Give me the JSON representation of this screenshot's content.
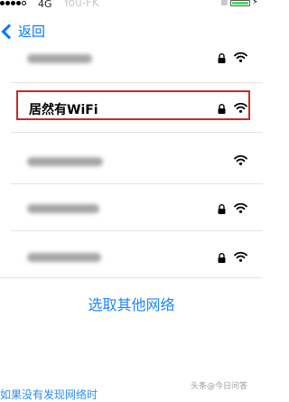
{
  "status_bar": {
    "carrier": "4G",
    "watermark": "You-FK",
    "battery_color": "#4cd964"
  },
  "nav": {
    "back_label": "返回",
    "back_icon": "chevron-left-icon",
    "accent": "#007aff"
  },
  "networks": [
    {
      "name": "",
      "blurred": true,
      "locked": true
    },
    {
      "name": "居然有WiFi",
      "blurred": false,
      "locked": true,
      "highlighted": true
    },
    {
      "name": "",
      "blurred": true,
      "locked": false
    },
    {
      "name": "",
      "blurred": true,
      "locked": true
    },
    {
      "name": "",
      "blurred": true,
      "locked": true
    }
  ],
  "other_network_label": "选取其他网络",
  "bottom_partial_text": "如果没有发现网络时",
  "watermark_bottom": "头条@今日问答",
  "colors": {
    "highlight_border": "#c62a2a",
    "link": "#1a86ff"
  }
}
